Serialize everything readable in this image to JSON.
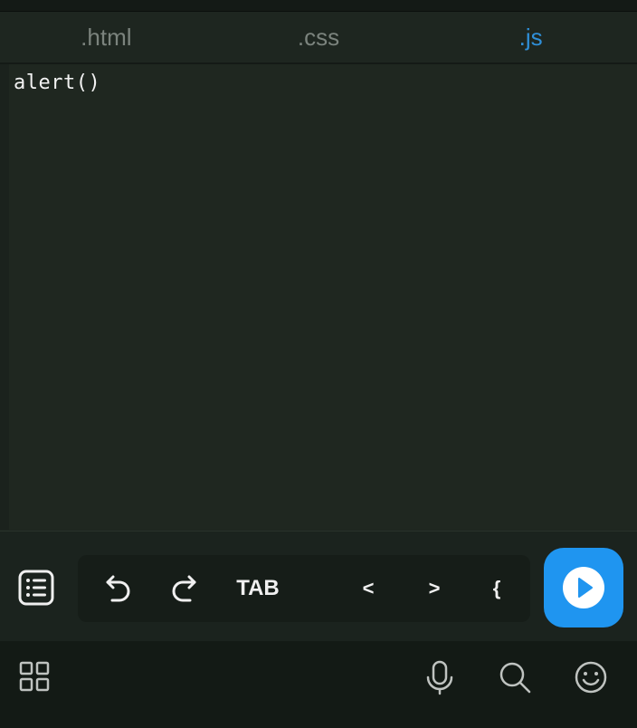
{
  "tabs": [
    {
      "label": ".html",
      "active": false
    },
    {
      "label": ".css",
      "active": false
    },
    {
      "label": ".js",
      "active": true
    }
  ],
  "editor": {
    "code": "alert()"
  },
  "toolbar": {
    "keys": {
      "tab": "TAB",
      "lt": "<",
      "gt": ">",
      "brace": "{"
    },
    "icons": {
      "list": "list-icon",
      "undo": "undo-icon",
      "redo": "redo-icon",
      "run": "play-icon"
    }
  },
  "bottom_bar": {
    "icons": [
      "grid-icon",
      "microphone-icon",
      "search-icon",
      "smile-icon"
    ]
  },
  "colors": {
    "background": "#1e2620",
    "active_tab": "#2f8fd8",
    "run_button": "#1f95f0",
    "text": "#f0f0f0"
  }
}
